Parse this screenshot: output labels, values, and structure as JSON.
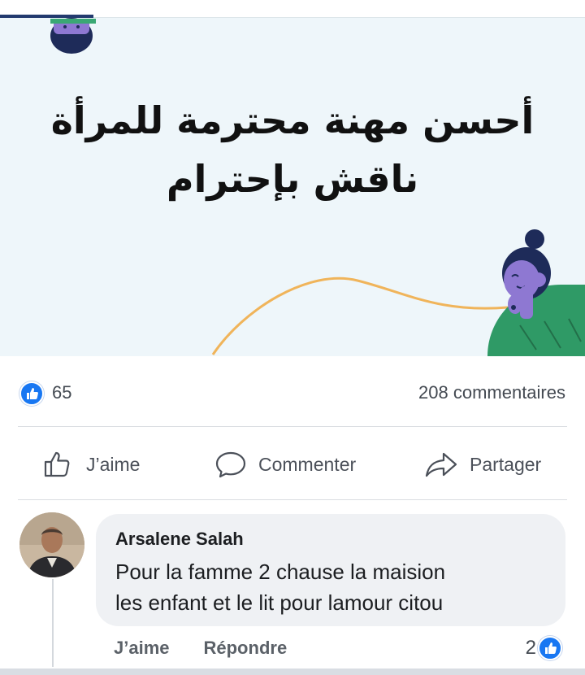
{
  "post": {
    "headline_line1": "أحسن مهنة محترمة للمرأة",
    "headline_line2": "ناقش بإحترام",
    "like_count": "65",
    "comment_count": "208 commentaires"
  },
  "actions": {
    "like_label": "J’aime",
    "comment_label": "Commenter",
    "share_label": "Partager"
  },
  "comment": {
    "author": "Arsalene Salah",
    "text_line1": "Pour la famme 2 chause la maision",
    "text_line2": "les enfant et le lit pour lamour citou",
    "like_label": "J’aime",
    "reply_label": "Répondre",
    "like_count": "2"
  },
  "colors": {
    "accent": "#1877f2",
    "image_bg": "#eef6fa",
    "bubble_bg": "#eff1f4",
    "illustration_purple": "#8e78d2",
    "illustration_green": "#2f9a66",
    "illustration_navy": "#1e2b59",
    "curve_orange": "#f0b45a"
  },
  "icons": [
    "like-icon",
    "thumbs-up-outline-icon",
    "speech-bubble-icon",
    "share-arrow-icon"
  ]
}
